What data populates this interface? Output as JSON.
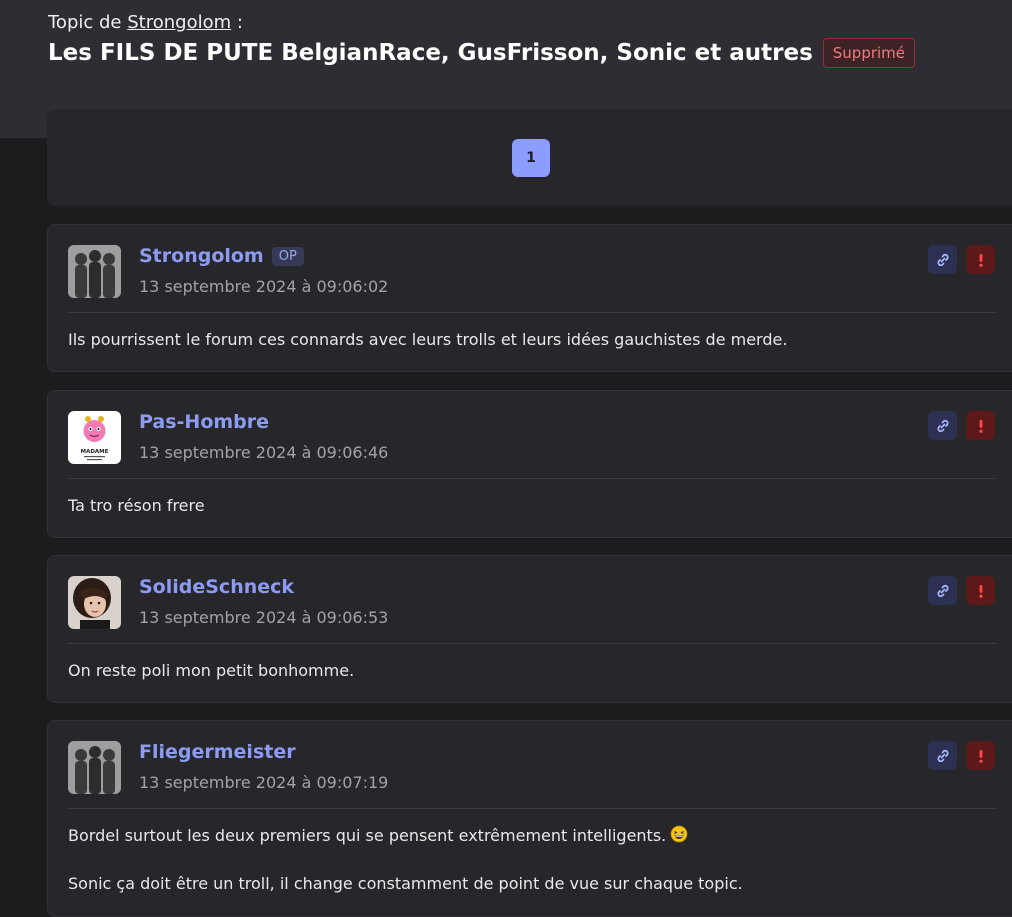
{
  "topic": {
    "prefix": "Topic de",
    "author_link": "Strongolom",
    "suffix": ":",
    "title": "Les FILS DE PUTE BelgianRace, GusFrisson, Sonic et autres",
    "status_badge": "Supprimé"
  },
  "pagination": {
    "current_page": "1"
  },
  "posts": [
    {
      "author": "Strongolom",
      "op_badge": "OP",
      "date": "13 septembre 2024 à 09:06:02",
      "body": [
        "Ils pourrissent le forum ces connards avec leurs trolls et leurs idées gauchistes de merde."
      ],
      "avatar": "silhouettes-avatar"
    },
    {
      "author": "Pas-Hombre",
      "date": "13 septembre 2024 à 09:06:46",
      "body": [
        "Ta tro réson frere"
      ],
      "avatar": "pink-character-avatar",
      "avatar_text": "MADAME"
    },
    {
      "author": "SolideSchneck",
      "date": "13 septembre 2024 à 09:06:53",
      "body": [
        "On reste poli mon petit bonhomme."
      ],
      "avatar": "photo-avatar"
    },
    {
      "author": "Fliegermeister",
      "date": "13 septembre 2024 à 09:07:19",
      "body": [
        "Bordel surtout les deux premiers qui se pensent extrêmement intelligents.",
        "Sonic ça doit être un troll, il change constamment de point de vue sur chaque topic."
      ],
      "emoji": "laughing-emoji",
      "avatar": "silhouettes-avatar"
    }
  ],
  "colors": {
    "accent": "#8d9cf2",
    "report": "#5d1818",
    "badge_deleted": "#f2797d"
  }
}
